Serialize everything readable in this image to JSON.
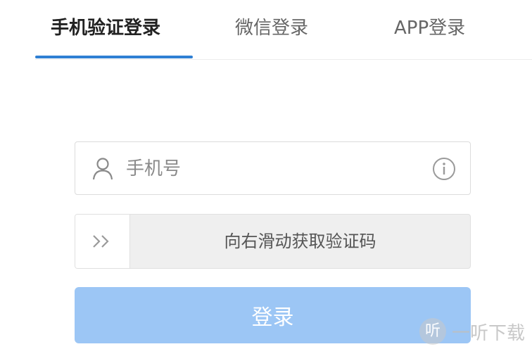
{
  "tabs": [
    {
      "label": "手机验证登录",
      "active": true
    },
    {
      "label": "微信登录",
      "active": false
    },
    {
      "label": "APP登录",
      "active": false
    }
  ],
  "phone_field": {
    "placeholder": "手机号",
    "value": "",
    "icon": "user-icon",
    "trailing_icon": "info-icon"
  },
  "slider": {
    "handle_icon": "double-chevron-right-icon",
    "text": "向右滑动获取验证码"
  },
  "login_button": {
    "label": "登录",
    "color": "#9cc6f5"
  },
  "watermark": {
    "logo_text": "听",
    "text": "一听下载"
  },
  "colors": {
    "accent": "#2f7fd3"
  }
}
